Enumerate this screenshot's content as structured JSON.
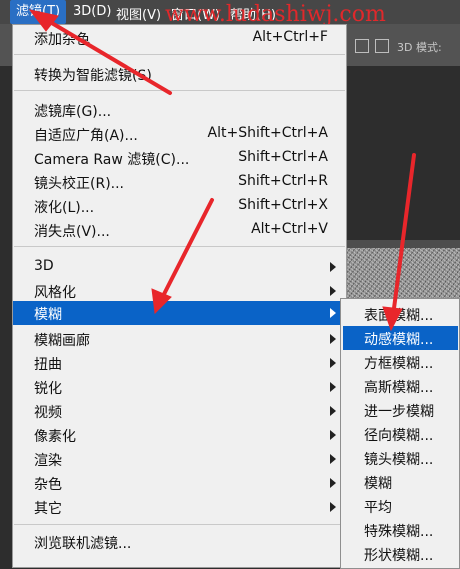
{
  "menubar": {
    "items": [
      {
        "label": "滤镜(T)",
        "active": true
      },
      {
        "label": "3D(D)"
      },
      {
        "label": "视图(V)"
      },
      {
        "label": "窗口(W)"
      },
      {
        "label": "帮助(H)"
      }
    ],
    "watermark": "www.ludashiwj.com"
  },
  "options_bar": {
    "mode_label": "3D 模式:"
  },
  "filter_menu": {
    "items": [
      {
        "label": "添加杂色",
        "shortcut": "Alt+Ctrl+F"
      },
      {
        "label": "转换为智能滤镜(S)"
      },
      {
        "label": "滤镜库(G)..."
      },
      {
        "label": "自适应广角(A)...",
        "shortcut": "Alt+Shift+Ctrl+A"
      },
      {
        "label": "Camera Raw 滤镜(C)...",
        "shortcut": "Shift+Ctrl+A"
      },
      {
        "label": "镜头校正(R)...",
        "shortcut": "Shift+Ctrl+R"
      },
      {
        "label": "液化(L)...",
        "shortcut": "Shift+Ctrl+X"
      },
      {
        "label": "消失点(V)...",
        "shortcut": "Alt+Ctrl+V"
      },
      {
        "label": "3D"
      },
      {
        "label": "风格化"
      },
      {
        "label": "模糊"
      },
      {
        "label": "模糊画廊"
      },
      {
        "label": "扭曲"
      },
      {
        "label": "锐化"
      },
      {
        "label": "视频"
      },
      {
        "label": "像素化"
      },
      {
        "label": "渲染"
      },
      {
        "label": "杂色"
      },
      {
        "label": "其它"
      },
      {
        "label": "浏览联机滤镜..."
      }
    ]
  },
  "blur_submenu": {
    "items": [
      {
        "label": "表面模糊..."
      },
      {
        "label": "动感模糊..."
      },
      {
        "label": "方框模糊..."
      },
      {
        "label": "高斯模糊..."
      },
      {
        "label": "进一步模糊"
      },
      {
        "label": "径向模糊..."
      },
      {
        "label": "镜头模糊..."
      },
      {
        "label": "模糊"
      },
      {
        "label": "平均"
      },
      {
        "label": "特殊模糊..."
      },
      {
        "label": "形状模糊..."
      }
    ]
  },
  "colors": {
    "highlight": "#0a63c7",
    "annotation": "#e8262b"
  }
}
